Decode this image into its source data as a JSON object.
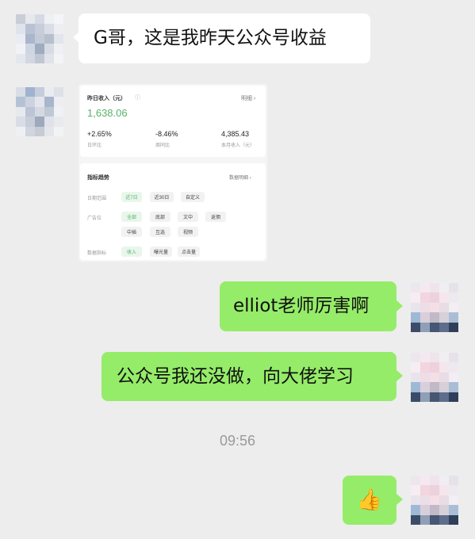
{
  "messages": {
    "m1": "G哥，这是我昨天公众号收益",
    "m3": "elliot老师厉害啊",
    "m4": "公众号我还没做，向大佬学习",
    "time": "09:56",
    "m5_emoji": "👍"
  },
  "shared_image": {
    "income_title": "昨日收入（元）",
    "detail_link": "明细 ›",
    "income_value": "1,638.06",
    "stats": [
      {
        "value": "+2.65%",
        "label": "日环比"
      },
      {
        "value": "-8.46%",
        "label": "周同比"
      },
      {
        "value": "4,385.43",
        "label": "本月收入（元）"
      }
    ],
    "trend_title": "指标趋势",
    "trend_link": "数据明细 ›",
    "date_label": "日期范围",
    "date_options": [
      "近7日",
      "近30日",
      "自定义"
    ],
    "ad_label": "广告位",
    "ad_options_row1": [
      "全部",
      "底部",
      "文中",
      "返佣"
    ],
    "ad_options_row2": [
      "中插",
      "互选",
      "视频"
    ],
    "metric_label": "数据指标",
    "metric_options": [
      "收入",
      "曝光量",
      "点击量"
    ]
  },
  "colors": {
    "background": "#ededed",
    "left_bubble": "#ffffff",
    "right_bubble": "#95ec69",
    "income_green": "#56b36a"
  }
}
